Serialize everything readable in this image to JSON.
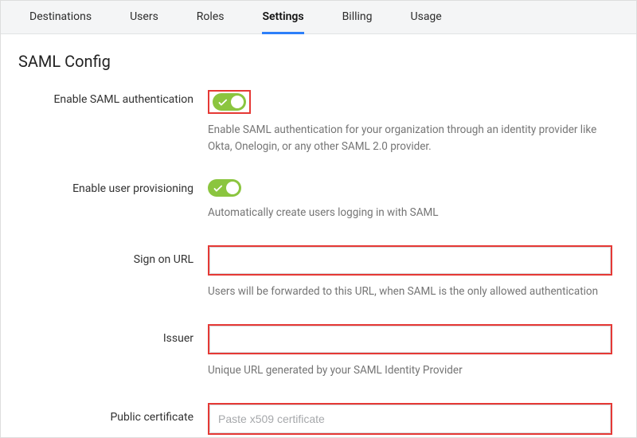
{
  "tabs": {
    "items": [
      {
        "label": "Destinations",
        "active": false
      },
      {
        "label": "Users",
        "active": false
      },
      {
        "label": "Roles",
        "active": false
      },
      {
        "label": "Settings",
        "active": true
      },
      {
        "label": "Billing",
        "active": false
      },
      {
        "label": "Usage",
        "active": false
      }
    ]
  },
  "page": {
    "title": "SAML Config"
  },
  "saml": {
    "enable_label": "Enable SAML authentication",
    "enable_help": "Enable SAML authentication for your organization through an identity provider like Okta, Onelogin, or any other SAML 2.0 provider.",
    "provisioning_label": "Enable user provisioning",
    "provisioning_help": "Automatically create users logging in with SAML",
    "signon_label": "Sign on URL",
    "signon_value": "",
    "signon_help": "Users will be forwarded to this URL, when SAML is the only allowed authentication",
    "issuer_label": "Issuer",
    "issuer_value": "",
    "issuer_help": "Unique URL generated by your SAML Identity Provider",
    "cert_label": "Public certificate",
    "cert_value": "",
    "cert_placeholder": "Paste x509 certificate"
  }
}
